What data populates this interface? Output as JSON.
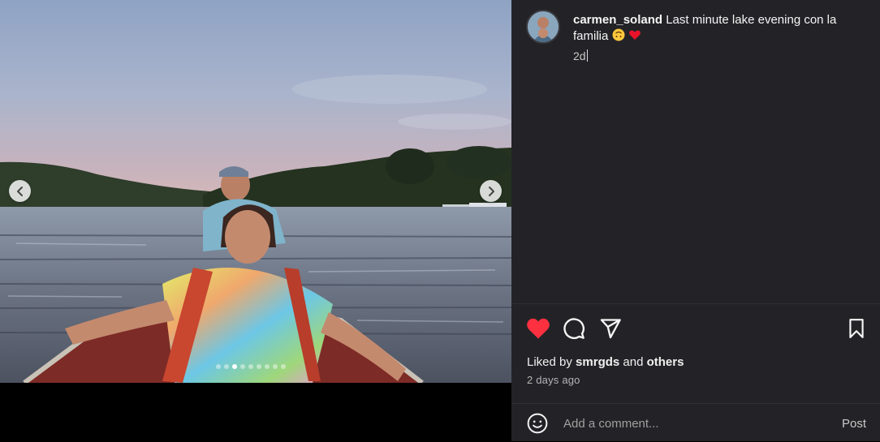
{
  "post": {
    "username": "carmen_soland",
    "caption": "Last minute lake evening con la familia",
    "caption_emojis": [
      "upside-down-face-emoji",
      "red-heart-emoji"
    ],
    "relative_time": "2d"
  },
  "media": {
    "carousel_total": 9,
    "carousel_active": 3
  },
  "engagement": {
    "liked": true,
    "liked_by_prefix": "Liked by",
    "liked_by_user": "smrgds",
    "liked_by_joiner": "and",
    "liked_by_others": "others",
    "posted_ago": "2 days ago"
  },
  "comment": {
    "placeholder": "Add a comment...",
    "post_label": "Post"
  },
  "icons": {
    "like": "heart-filled-icon",
    "comment": "comment-bubble-icon",
    "share": "paper-plane-icon",
    "save": "bookmark-icon",
    "emoji": "emoji-smile-icon",
    "prev": "chevron-left-icon",
    "next": "chevron-right-icon"
  },
  "colors": {
    "like_red": "#ff3040",
    "panel_bg": "#232327"
  }
}
